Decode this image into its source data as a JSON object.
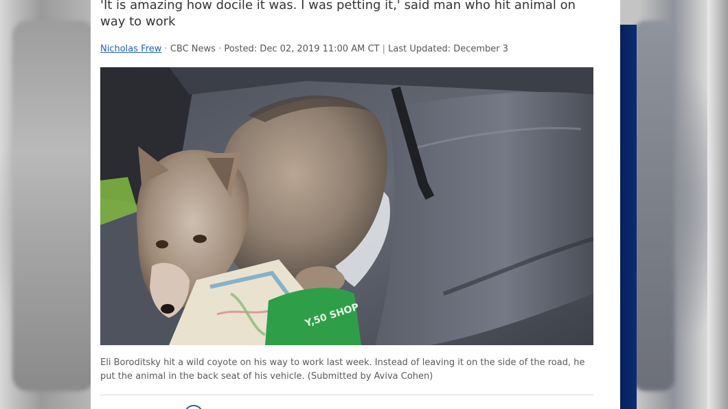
{
  "article": {
    "headline": "'It is amazing how docile it was. I was petting it,' said man who hit animal on way to work",
    "byline": {
      "author": "Nicholas Frew",
      "source": "CBC News",
      "posted": "Posted: Dec 02, 2019 11:00 AM CT",
      "updated": "Last Updated: December 3",
      "separator_dot": "·",
      "separator_pipe": "|"
    },
    "photo": {
      "bag_text": "Y,50 SHOP"
    },
    "caption": "Eli Boroditsky hit a wild coyote on his way to work last week. Instead of leaving it on the side of the road, he put the animal in the back seat of his vehicle. (Submitted by Aviva Cohen)"
  },
  "colors": {
    "link": "#1d61b5",
    "navy_bar": "#0b2d73",
    "text": "#333333"
  },
  "icons": {
    "share": "share-circle-icon"
  }
}
